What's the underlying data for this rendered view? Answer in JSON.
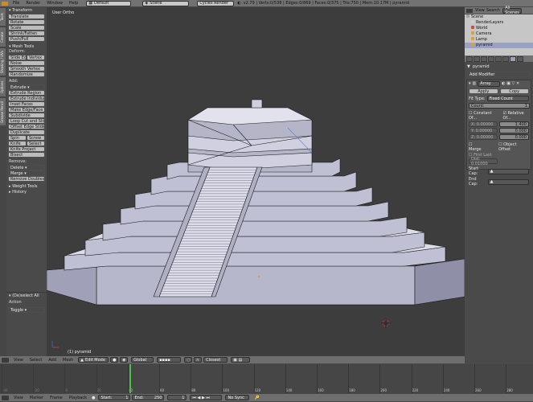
{
  "top_menu": [
    "File",
    "Render",
    "Window",
    "Help"
  ],
  "screen_layout": "Default",
  "scene_name": "Scene",
  "render_engine": "Cycles Render",
  "stats": "v2.79 | Verts:0/538 | Edges:0/869 | Faces:0/375 | Tris:750 | Mem:10.17M | pyramid",
  "tool_shelf": {
    "tabs": [
      "Tools",
      "Create",
      "Shading / UVs",
      "Options",
      "Grease Pencil"
    ],
    "transform_header": "Transform",
    "transform_items": [
      "Translate",
      "Rotate",
      "Scale",
      "Shrink/Fatten",
      "Push/Pull"
    ],
    "mesh_tools_header": "Mesh Tools",
    "deform_label": "Deform:",
    "slide_edge": "Slide Edge",
    "vertex": "Vertex",
    "deform_items": [
      "Noise",
      "Smooth Vertex",
      "Randomize"
    ],
    "add_label": "Add:",
    "extrude": "Extrude",
    "add_items": [
      "Extrude Region",
      "Extrude Individual",
      "Inset Faces",
      "Make Edge/Face",
      "Subdivide",
      "Loop Cut and Slide",
      "Offset Edge Slide",
      "Duplicate"
    ],
    "spin": "Spin",
    "screw": "Screw",
    "knife": "Knife",
    "select": "Select",
    "add_items2": [
      "Knife Project",
      "Bisect"
    ],
    "remove_label": "Remove:",
    "delete": "Delete",
    "merge": "Merge",
    "remove_doubles": "Remove Doubles",
    "weight_tools": "Weight Tools",
    "history": "History",
    "deselect_all": "(De)select All",
    "action_label": "Action",
    "action_value": "Toggle"
  },
  "viewport": {
    "title": "User Ortho",
    "object_label": "(1) pyramid"
  },
  "outliner": {
    "view": "View",
    "search": "Search",
    "all_scenes": "All Scenes",
    "items": [
      {
        "name": "Scene",
        "indent": 0,
        "color": "#a0a0a0"
      },
      {
        "name": "RenderLayers",
        "indent": 1,
        "color": "#cfcfcf"
      },
      {
        "name": "World",
        "indent": 1,
        "color": "#c64b4b"
      },
      {
        "name": "Camera",
        "indent": 1,
        "color": "#e0a030"
      },
      {
        "name": "Lamp",
        "indent": 1,
        "color": "#e0a030"
      },
      {
        "name": "pyramid",
        "indent": 1,
        "color": "#e0a030"
      }
    ]
  },
  "properties": {
    "object_name": "pyramid",
    "add_modifier": "Add Modifier",
    "modifier_name": "Array",
    "apply": "Apply",
    "copy": "Copy",
    "fit_type_label": "Fit Type:",
    "fit_type": "Fixed Count",
    "count_label": "Count:",
    "count": "1",
    "constant_offset": "Constant Of...",
    "relative_offset": "Relative Of...",
    "const_vals": [
      "X: 0.00000",
      "Y: 0.00000",
      "Z: 0.00000"
    ],
    "rel_vals": [
      "1.400",
      "0.000",
      "0.000"
    ],
    "merge": "Merge",
    "object_offset": "Object Offset",
    "first_last": "First Last",
    "distance": "Dist: 0.01000",
    "start_cap": "Start Cap:",
    "end_cap": "End Cap:"
  },
  "viewport_header": {
    "view": "View",
    "select": "Select",
    "add": "Add",
    "mesh": "Mesh",
    "mode": "Edit Mode",
    "orientation": "Global",
    "snap": "Closest"
  },
  "timeline": {
    "ticks": [
      "-40",
      "-20",
      "0",
      "20",
      "40",
      "60",
      "80",
      "100",
      "120",
      "140",
      "160",
      "180",
      "200",
      "220",
      "240",
      "260",
      "280"
    ],
    "view": "View",
    "marker": "Marker",
    "frame": "Frame",
    "playback": "Playback",
    "start": "Start:",
    "start_val": "1",
    "end": "End:",
    "end_val": "250",
    "current": "1",
    "sync": "No Sync"
  }
}
